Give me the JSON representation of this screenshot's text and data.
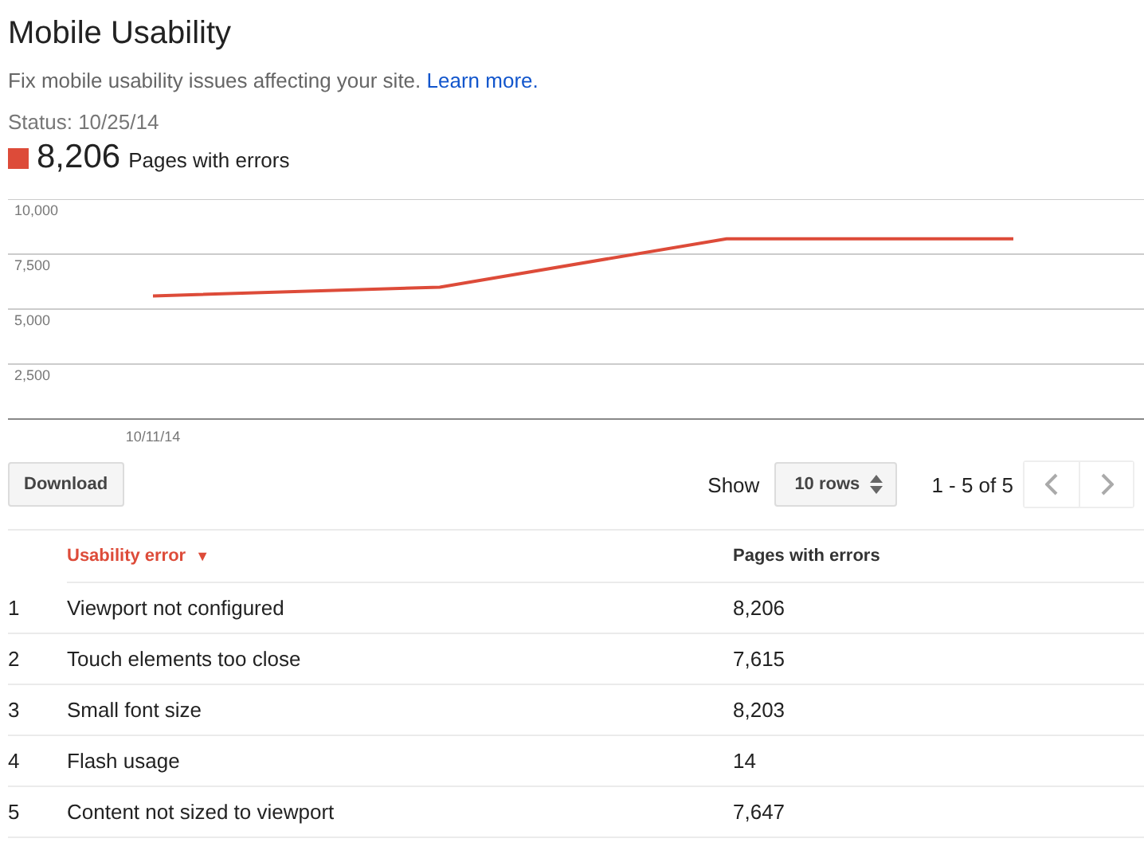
{
  "header": {
    "title": "Mobile Usability",
    "description": "Fix mobile usability issues affecting your site.",
    "learn_more_link": "Learn more.",
    "status": "Status: 10/25/14",
    "summary": {
      "count": "8,206",
      "label": "Pages with errors",
      "color": "#dd4b39"
    }
  },
  "chart_start_label": "10/11/14",
  "chart_data": {
    "type": "line",
    "grid": true,
    "ylim": [
      0,
      10000
    ],
    "yticks": [
      {
        "value": 2500,
        "label": "2,500"
      },
      {
        "value": 5000,
        "label": "5,000"
      },
      {
        "value": 7500,
        "label": "7,500"
      },
      {
        "value": 10000,
        "label": "10,000"
      }
    ],
    "series": [
      {
        "color": "#dd4b39",
        "values": [
          5600,
          6000,
          8200,
          8200
        ]
      }
    ]
  },
  "toolbar": {
    "download": "Download",
    "show_label": "Show",
    "rows_select": "10 rows",
    "range": "1 - 5 of 5"
  },
  "table": {
    "columns": [
      {
        "label": "Usability error",
        "sort_icon": "▼",
        "sorted": true
      },
      {
        "label": "Pages with errors",
        "sorted": false
      }
    ],
    "rows": [
      {
        "index": "1",
        "error": "Viewport not configured",
        "pages": "8,206"
      },
      {
        "index": "2",
        "error": "Touch elements too close",
        "pages": "7,615"
      },
      {
        "index": "3",
        "error": "Small font size",
        "pages": "8,203"
      },
      {
        "index": "4",
        "error": "Flash usage",
        "pages": "14"
      },
      {
        "index": "5",
        "error": "Content not sized to viewport",
        "pages": "7,647"
      }
    ]
  }
}
